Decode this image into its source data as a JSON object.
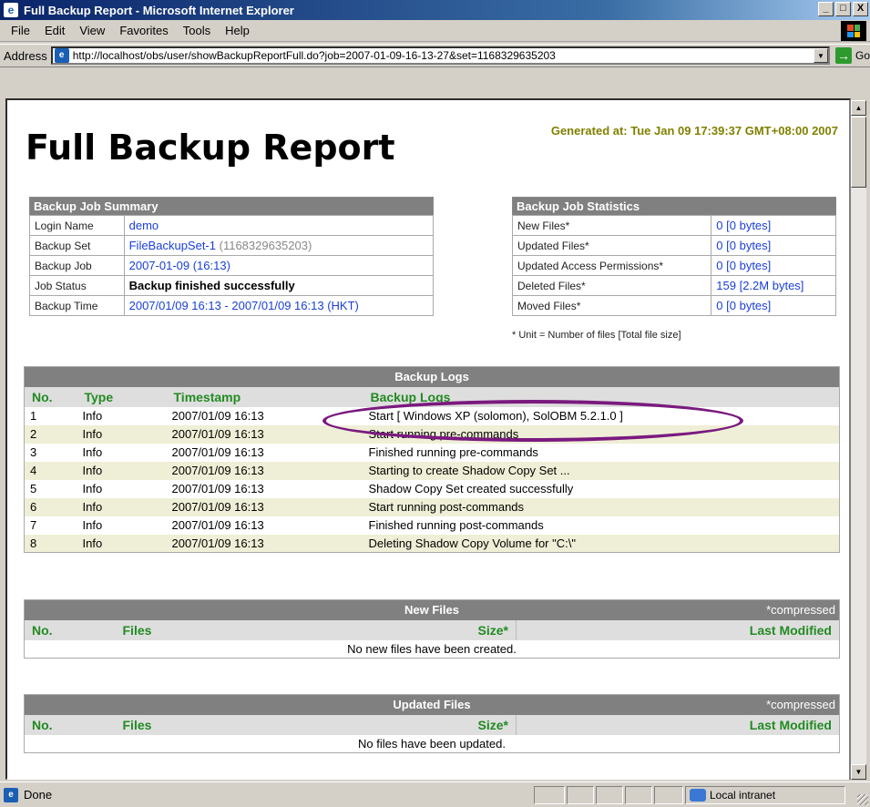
{
  "window": {
    "title": "Full Backup Report - Microsoft Internet Explorer",
    "minimize": "_",
    "maximize": "□",
    "close": "X"
  },
  "menu": [
    "File",
    "Edit",
    "View",
    "Favorites",
    "Tools",
    "Help"
  ],
  "address": {
    "label": "Address",
    "url": "http://localhost/obs/user/showBackupReportFull.do?job=2007-01-09-16-13-27&set=1168329635203",
    "go_label": "Go"
  },
  "report": {
    "generated": "Generated at: Tue Jan 09 17:39:37 GMT+08:00 2007",
    "title": "Full Backup Report",
    "summary": {
      "header": "Backup Job Summary",
      "login_name_label": "Login Name",
      "login_name": "demo",
      "backup_set_label": "Backup Set",
      "backup_set_name": "FileBackupSet-1",
      "backup_set_id": "(1168329635203)",
      "backup_job_label": "Backup Job",
      "backup_job": "2007-01-09 (16:13)",
      "job_status_label": "Job Status",
      "job_status": "Backup finished successfully",
      "backup_time_label": "Backup Time",
      "backup_time": "2007/01/09 16:13 - 2007/01/09 16:13 (HKT)"
    },
    "statistics": {
      "header": "Backup Job Statistics",
      "rows": [
        {
          "label": "New Files*",
          "value": "0 [0 bytes]"
        },
        {
          "label": "Updated Files*",
          "value": "0 [0 bytes]"
        },
        {
          "label": "Updated Access Permissions*",
          "value": "0 [0 bytes]"
        },
        {
          "label": "Deleted Files*",
          "value": "159 [2.2M bytes]"
        },
        {
          "label": "Moved Files*",
          "value": "0 [0 bytes]"
        }
      ],
      "note": "* Unit = Number of files [Total file size]"
    },
    "logs": {
      "header": "Backup Logs",
      "columns": [
        "No.",
        "Type",
        "Timestamp",
        "Backup Logs"
      ],
      "rows": [
        {
          "no": "1",
          "type": "Info",
          "timestamp": "2007/01/09 16:13",
          "message": "Start [ Windows XP (solomon), SolOBM 5.2.1.0 ]"
        },
        {
          "no": "2",
          "type": "Info",
          "timestamp": "2007/01/09 16:13",
          "message": "Start running pre-commands"
        },
        {
          "no": "3",
          "type": "Info",
          "timestamp": "2007/01/09 16:13",
          "message": "Finished running pre-commands"
        },
        {
          "no": "4",
          "type": "Info",
          "timestamp": "2007/01/09 16:13",
          "message": "Starting to create Shadow Copy Set ..."
        },
        {
          "no": "5",
          "type": "Info",
          "timestamp": "2007/01/09 16:13",
          "message": "Shadow Copy Set created successfully"
        },
        {
          "no": "6",
          "type": "Info",
          "timestamp": "2007/01/09 16:13",
          "message": "Start running post-commands"
        },
        {
          "no": "7",
          "type": "Info",
          "timestamp": "2007/01/09 16:13",
          "message": "Finished running post-commands"
        },
        {
          "no": "8",
          "type": "Info",
          "timestamp": "2007/01/09 16:13",
          "message": "Deleting Shadow Copy Volume for \"C:\\\""
        }
      ]
    },
    "new_files": {
      "header": "New Files",
      "compressed": "*compressed",
      "col_no": "No.",
      "col_files": "Files",
      "col_size": "Size*",
      "col_modified": "Last Modified",
      "empty": "No new files have been created."
    },
    "updated_files": {
      "header": "Updated Files",
      "compressed": "*compressed",
      "col_no": "No.",
      "col_files": "Files",
      "col_size": "Size*",
      "col_modified": "Last Modified",
      "empty": "No files have been updated."
    }
  },
  "status": {
    "text": "Done",
    "zone": "Local intranet"
  },
  "colors": {
    "highlight_ellipse": "#7a1a7f",
    "link": "#1a3fd6",
    "column_header": "#228b22"
  }
}
